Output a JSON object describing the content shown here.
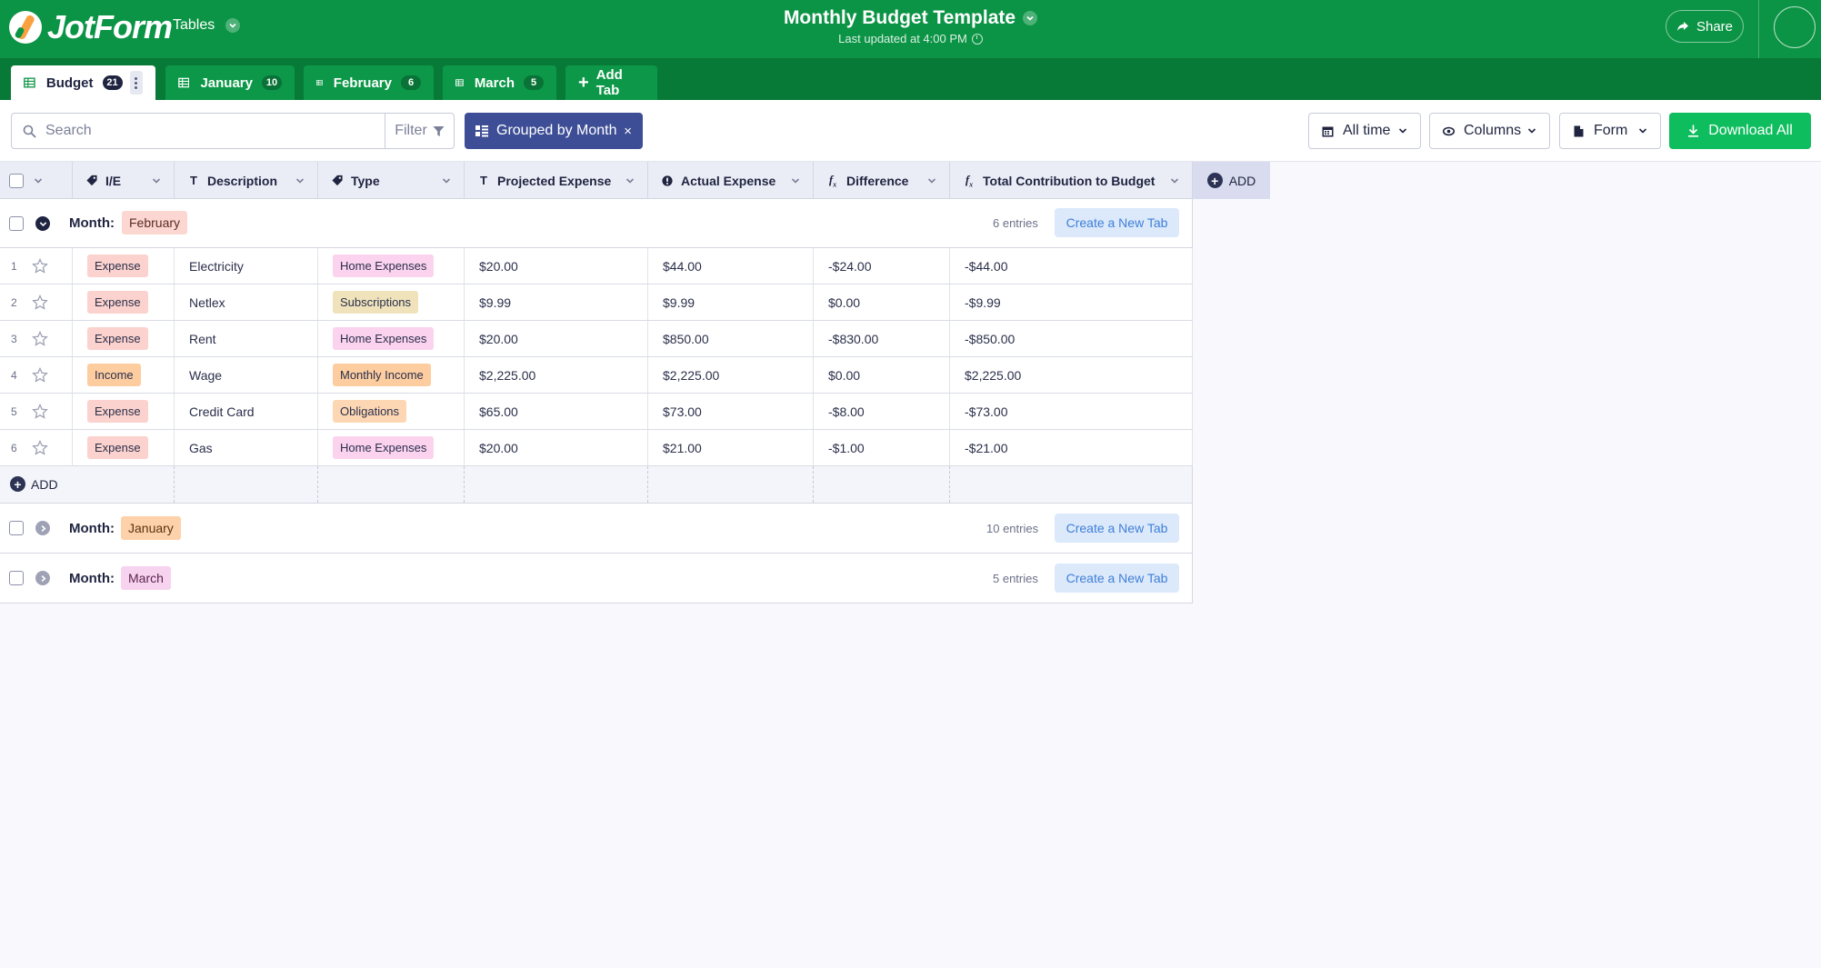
{
  "brand": {
    "name": "JotForm"
  },
  "topbar": {
    "tables_label": "Tables",
    "title": "Monthly Budget Template",
    "subtitle": "Last updated at 4:00 PM",
    "share_label": "Share"
  },
  "tabs": [
    {
      "label": "Budget",
      "count": "21",
      "active": true
    },
    {
      "label": "January",
      "count": "10"
    },
    {
      "label": "February",
      "count": "6"
    },
    {
      "label": "March",
      "count": "5"
    }
  ],
  "add_tab_label": "Add Tab",
  "toolbar": {
    "search_placeholder": "Search",
    "filter_label": "Filter",
    "grouped_label": "Grouped by Month",
    "grouped_close": "×",
    "time_label": "All time",
    "columns_label": "Columns",
    "form_label": "Form",
    "download_label": "Download All"
  },
  "columns": [
    {
      "label": "I/E",
      "type_icon": "tag-icon"
    },
    {
      "label": "Description",
      "type_icon": "text-icon"
    },
    {
      "label": "Type",
      "type_icon": "tag-icon"
    },
    {
      "label": "Projected Expense",
      "type_icon": "text-icon"
    },
    {
      "label": "Actual Expense",
      "type_icon": "info-icon"
    },
    {
      "label": "Difference",
      "type_icon": "formula-icon"
    },
    {
      "label": "Total Contribution to Budget",
      "type_icon": "formula-icon"
    }
  ],
  "add_column_label": "ADD",
  "groups": [
    {
      "prefix": "Month:",
      "month": "February",
      "entries": "6 entries",
      "new_tab_label": "Create a New Tab",
      "expanded": true,
      "chip_bg": "#fcd7d1",
      "chip_fg": "#5a2b24"
    },
    {
      "prefix": "Month:",
      "month": "January",
      "entries": "10 entries",
      "new_tab_label": "Create a New Tab",
      "expanded": false,
      "chip_bg": "#fdd1a9",
      "chip_fg": "#5a3412"
    },
    {
      "prefix": "Month:",
      "month": "March",
      "entries": "5 entries",
      "new_tab_label": "Create a New Tab",
      "expanded": false,
      "chip_bg": "#f8d3ef",
      "chip_fg": "#5b2550"
    }
  ],
  "rows": [
    {
      "n": "1",
      "ie": "Expense",
      "desc": "Electricity",
      "type": "Home Expenses",
      "projected": "$20.00",
      "actual": "$44.00",
      "diff": "-$24.00",
      "total": "-$44.00"
    },
    {
      "n": "2",
      "ie": "Expense",
      "desc": "Netlex",
      "type": "Subscriptions",
      "projected": "$9.99",
      "actual": "$9.99",
      "diff": "$0.00",
      "total": "-$9.99"
    },
    {
      "n": "3",
      "ie": "Expense",
      "desc": "Rent",
      "type": "Home Expenses",
      "projected": "$20.00",
      "actual": "$850.00",
      "diff": "-$830.00",
      "total": "-$850.00"
    },
    {
      "n": "4",
      "ie": "Income",
      "desc": "Wage",
      "type": "Monthly Income",
      "projected": "$2,225.00",
      "actual": "$2,225.00",
      "diff": "$0.00",
      "total": "$2,225.00"
    },
    {
      "n": "5",
      "ie": "Expense",
      "desc": "Credit Card",
      "type": "Obligations",
      "projected": "$65.00",
      "actual": "$73.00",
      "diff": "-$8.00",
      "total": "-$73.00"
    },
    {
      "n": "6",
      "ie": "Expense",
      "desc": "Gas",
      "type": "Home Expenses",
      "projected": "$20.00",
      "actual": "$21.00",
      "diff": "-$1.00",
      "total": "-$21.00"
    }
  ],
  "add_row_label": "ADD",
  "tag_colors": {
    "Expense": "#fbd2cd",
    "Income": "#fdcda0",
    "Home Expenses": "#fbd3ef",
    "Subscriptions": "#f0e3bc",
    "Monthly Income": "#fdcda0",
    "Obligations": "#fdd7b4"
  },
  "colors": {
    "topbar": "#0b9445",
    "tabsbar": "#087a38",
    "grouped_chip": "#3e4e96",
    "download": "#0ebe5e"
  }
}
